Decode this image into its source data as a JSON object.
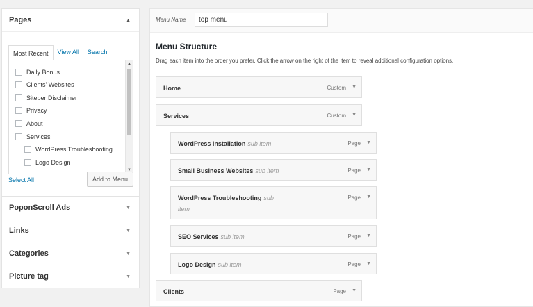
{
  "pages_box": {
    "title": "Pages",
    "tabs": [
      "Most Recent",
      "View All",
      "Search"
    ],
    "items": [
      "Daily Bonus",
      "Clients' Websites",
      "Siteber Disclaimer",
      "Privacy",
      "About",
      "Services",
      "WordPress Troubleshooting",
      "Logo Design"
    ],
    "select_all": "Select All",
    "add_button": "Add to Menu"
  },
  "accordions": [
    "PoponScroll Ads",
    "Links",
    "Categories",
    "Picture tag"
  ],
  "menu": {
    "name_label": "Menu Name",
    "name_value": "top menu",
    "structure_title": "Menu Structure",
    "structure_desc": "Drag each item into the order you prefer. Click the arrow on the right of the item to reveal additional configuration options.",
    "items": [
      {
        "title": "Home",
        "sub": "",
        "type": "Custom"
      },
      {
        "title": "Services",
        "sub": "",
        "type": "Custom"
      },
      {
        "title": "WordPress Installation",
        "sub": "sub item",
        "type": "Page"
      },
      {
        "title": "Small Business Websites",
        "sub": "sub item",
        "type": "Page"
      },
      {
        "title": "WordPress Troubleshooting",
        "sub": "sub",
        "sub2": "item",
        "type": "Page"
      },
      {
        "title": "SEO Services",
        "sub": "sub item",
        "type": "Page"
      },
      {
        "title": "Logo Design",
        "sub": "sub item",
        "type": "Page"
      },
      {
        "title": "Clients",
        "sub": "",
        "type": "Page"
      }
    ]
  },
  "icons": {
    "collapse": "caret-up-icon",
    "expand": "caret-down-icon"
  }
}
